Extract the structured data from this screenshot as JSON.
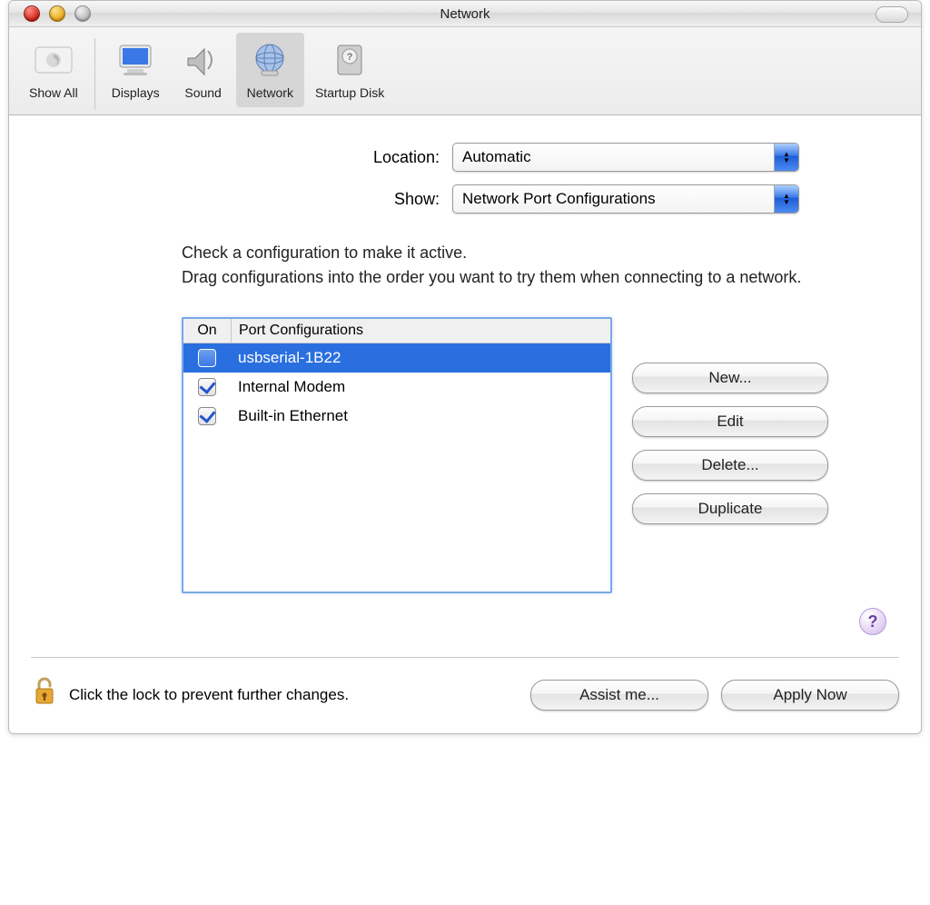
{
  "window": {
    "title": "Network"
  },
  "toolbar": {
    "items": [
      {
        "label": "Show All"
      },
      {
        "label": "Displays"
      },
      {
        "label": "Sound"
      },
      {
        "label": "Network"
      },
      {
        "label": "Startup Disk"
      }
    ]
  },
  "location": {
    "label": "Location:",
    "value": "Automatic"
  },
  "show": {
    "label": "Show:",
    "value": "Network Port Configurations"
  },
  "instructions": "Check a configuration to make it active.\nDrag configurations into the order you want to try them when connecting to a network.",
  "portbox": {
    "headers": {
      "on": "On",
      "pc": "Port Configurations"
    },
    "rows": [
      {
        "checked": false,
        "name": "usbserial-1B22",
        "selected": true
      },
      {
        "checked": true,
        "name": "Internal Modem",
        "selected": false
      },
      {
        "checked": true,
        "name": "Built-in Ethernet",
        "selected": false
      }
    ]
  },
  "sidebuttons": {
    "new": "New...",
    "edit": "Edit",
    "delete": "Delete...",
    "duplicate": "Duplicate"
  },
  "help": "?",
  "footer": {
    "lock_text": "Click the lock to prevent further changes.",
    "assist": "Assist me...",
    "apply": "Apply Now"
  }
}
